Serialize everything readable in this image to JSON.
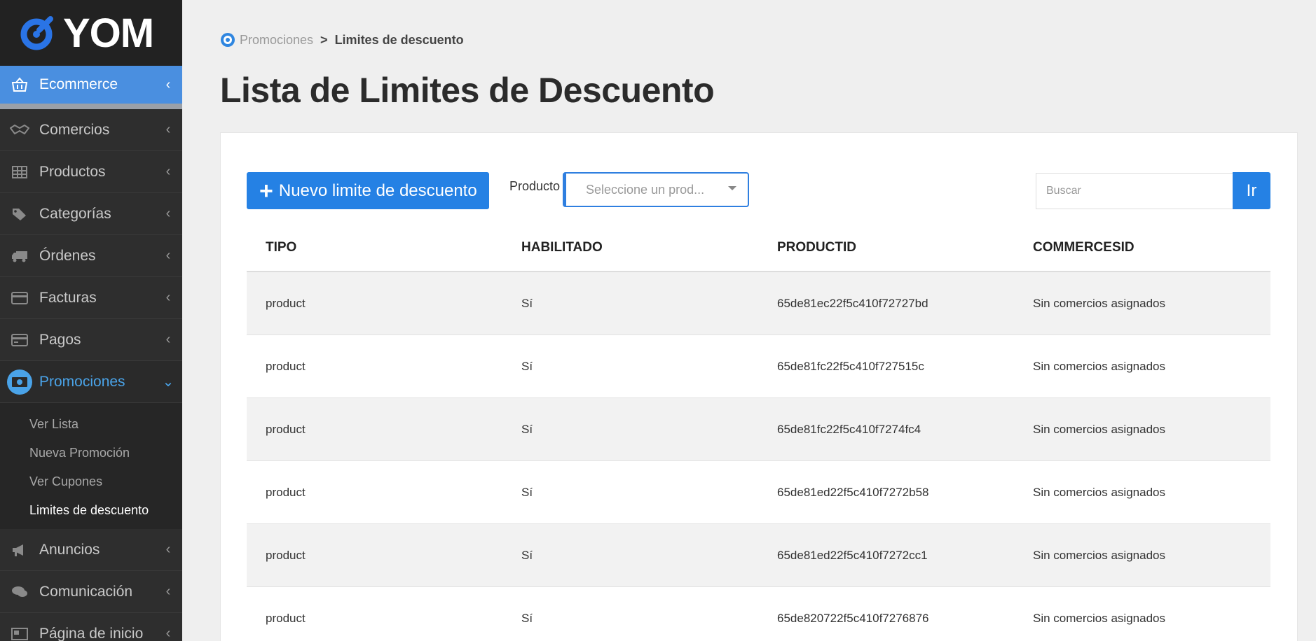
{
  "brand": {
    "name": "YOM"
  },
  "sidebar": {
    "items": [
      {
        "label": "Ecommerce",
        "icon": "basket-icon"
      },
      {
        "label": "Comercios",
        "icon": "handshake-icon"
      },
      {
        "label": "Productos",
        "icon": "grid-icon"
      },
      {
        "label": "Categorías",
        "icon": "tags-icon"
      },
      {
        "label": "Órdenes",
        "icon": "truck-icon"
      },
      {
        "label": "Facturas",
        "icon": "invoice-icon"
      },
      {
        "label": "Pagos",
        "icon": "credit-card-icon"
      },
      {
        "label": "Promociones",
        "icon": "money-icon"
      },
      {
        "label": "Anuncios",
        "icon": "megaphone-icon"
      },
      {
        "label": "Comunicación",
        "icon": "chat-icon"
      },
      {
        "label": "Página de inicio",
        "icon": "home-page-icon"
      }
    ],
    "submenu": [
      "Ver Lista",
      "Nueva Promoción",
      "Ver Cupones",
      "Limites de descuento"
    ]
  },
  "breadcrumb": {
    "parent": "Promociones",
    "separator": ">",
    "current": "Limites de descuento"
  },
  "page": {
    "title": "Lista de Limites de Descuento"
  },
  "toolbar": {
    "new_button": "Nuevo limite de descuento",
    "product_label": "Producto",
    "product_select_placeholder": "Seleccione un prod...",
    "search_placeholder": "Buscar",
    "go_button": "Ir"
  },
  "table": {
    "columns": [
      "TIPO",
      "HABILITADO",
      "PRODUCTID",
      "COMMERCESID"
    ],
    "rows": [
      [
        "product",
        "Sí",
        "65de81ec22f5c410f72727bd",
        "Sin comercios asignados"
      ],
      [
        "product",
        "Sí",
        "65de81fc22f5c410f727515c",
        "Sin comercios asignados"
      ],
      [
        "product",
        "Sí",
        "65de81fc22f5c410f7274fc4",
        "Sin comercios asignados"
      ],
      [
        "product",
        "Sí",
        "65de81ed22f5c410f7272b58",
        "Sin comercios asignados"
      ],
      [
        "product",
        "Sí",
        "65de81ed22f5c410f7272cc1",
        "Sin comercios asignados"
      ],
      [
        "product",
        "Sí",
        "65de820722f5c410f7276876",
        "Sin comercios asignados"
      ]
    ]
  },
  "colors": {
    "accent": "#2581e4",
    "sidebar_bg": "#2e2e2e",
    "active_nav": "#4a8fe0",
    "open_nav_text": "#4aa3e8"
  }
}
